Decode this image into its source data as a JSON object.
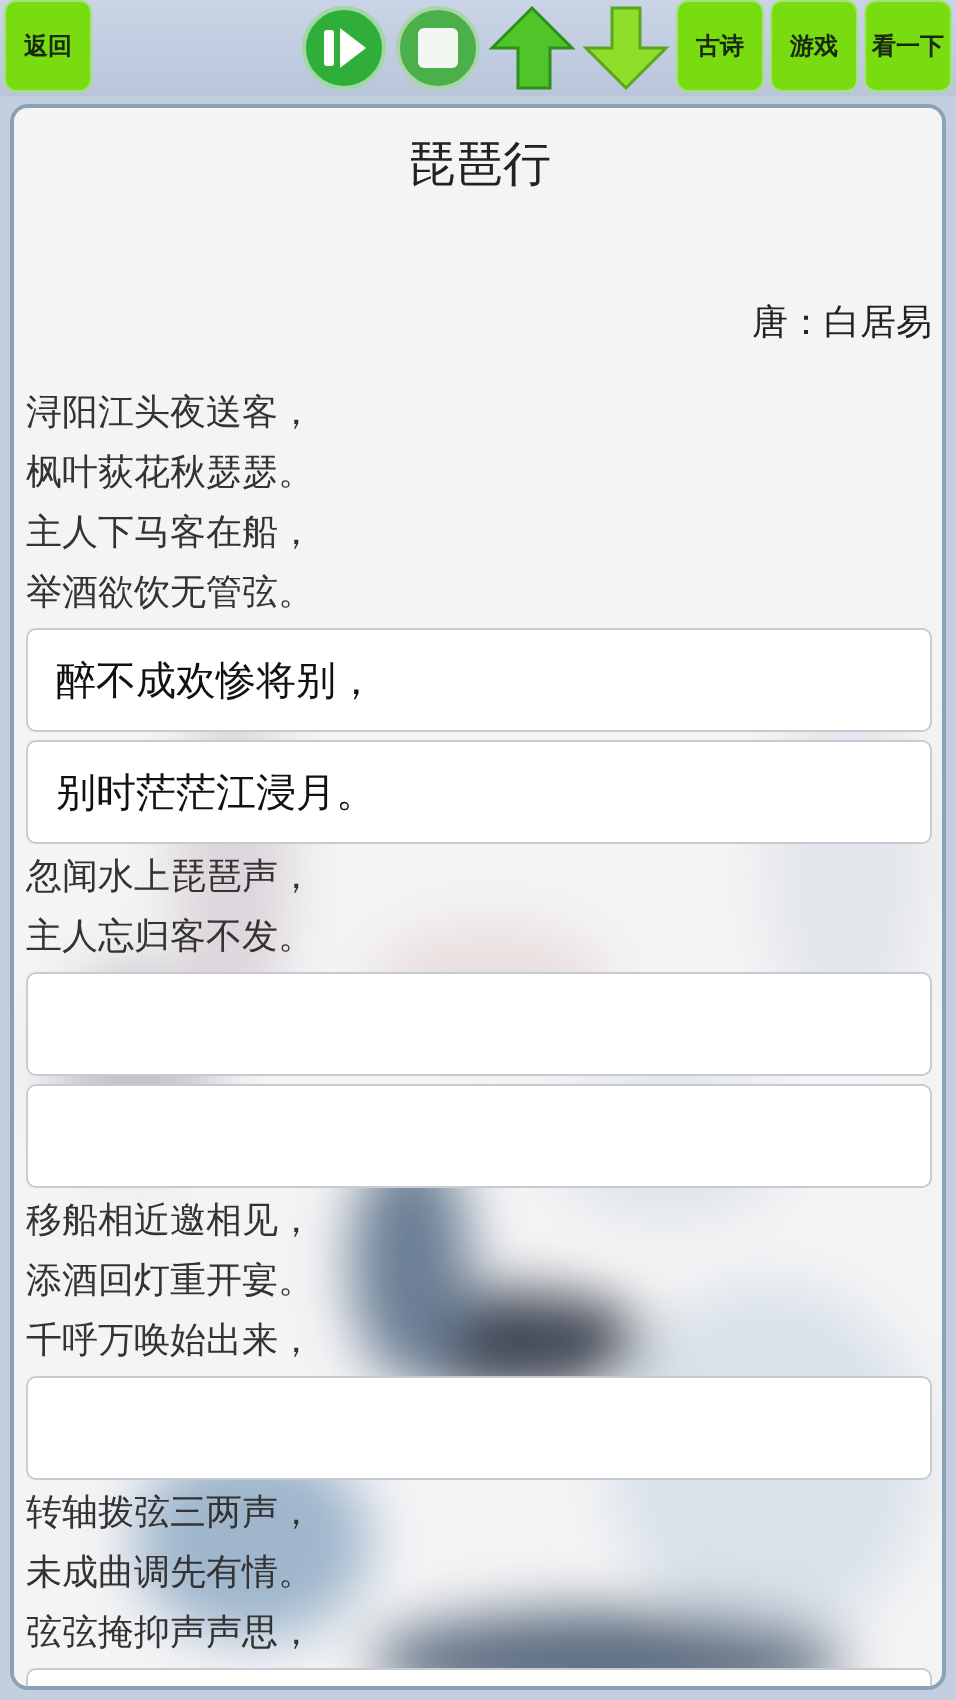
{
  "toolbar": {
    "back_button": "返回",
    "media_buttons": [
      {
        "kind": "play"
      },
      {
        "kind": "stop"
      },
      {
        "kind": "up"
      },
      {
        "kind": "down"
      }
    ],
    "right_buttons": [
      "古诗",
      "游戏",
      "看一下"
    ]
  },
  "poem": {
    "title": "琵琶行",
    "author": "唐：白居易",
    "items": [
      {
        "kind": "line",
        "text": "浔阳江头夜送客，"
      },
      {
        "kind": "line",
        "text": "枫叶荻花秋瑟瑟。"
      },
      {
        "kind": "line",
        "text": "主人下马客在船，"
      },
      {
        "kind": "line",
        "text": "举酒欲饮无管弦。"
      },
      {
        "kind": "answer",
        "value": "醉不成欢惨将别，"
      },
      {
        "kind": "answer",
        "value": "别时茫茫江浸月。"
      },
      {
        "kind": "line",
        "text": "忽闻水上琵琶声，"
      },
      {
        "kind": "line",
        "text": "主人忘归客不发。"
      },
      {
        "kind": "answer"
      },
      {
        "kind": "answer"
      },
      {
        "kind": "line",
        "text": "移船相近邀相见，"
      },
      {
        "kind": "line",
        "text": "添酒回灯重开宴。"
      },
      {
        "kind": "line",
        "text": "千呼万唤始出来，"
      },
      {
        "kind": "answer"
      },
      {
        "kind": "line",
        "text": "转轴拨弦三两声，"
      },
      {
        "kind": "line",
        "text": "未成曲调先有情。"
      },
      {
        "kind": "line",
        "text": "弦弦掩抑声声思，"
      },
      {
        "kind": "answer"
      }
    ]
  }
}
